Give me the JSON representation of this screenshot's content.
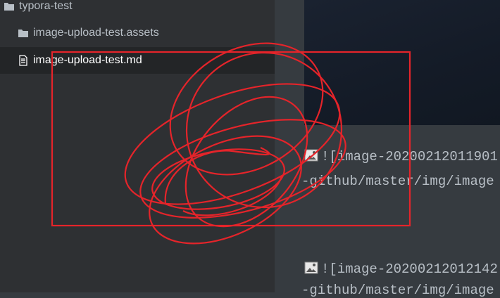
{
  "sidebar": {
    "root_folder": {
      "label": "typora-test",
      "icon": "folder-icon"
    },
    "items": [
      {
        "label": "image-upload-test.assets",
        "icon": "folder-icon"
      },
      {
        "label": "image-upload-test.md",
        "icon": "file-text-icon",
        "active": true
      }
    ]
  },
  "editor": {
    "lines": [
      {
        "text": "![image-20200212011901",
        "icon": "image-icon"
      },
      {
        "text": "-github/master/img/image"
      },
      {
        "text": "![image-20200212012142",
        "icon": "image-icon"
      },
      {
        "text": "-github/master/img/image"
      }
    ]
  },
  "annotation": {
    "color": "#e5242a"
  }
}
